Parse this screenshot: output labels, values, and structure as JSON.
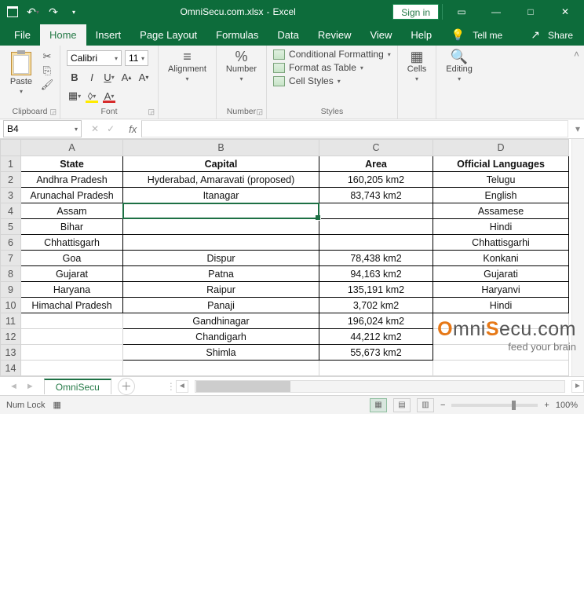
{
  "title": {
    "filename": "OmniSecu.com.xlsx",
    "appname": "Excel",
    "signin": "Sign in"
  },
  "tabs": {
    "file": "File",
    "home": "Home",
    "insert": "Insert",
    "pagelayout": "Page Layout",
    "formulas": "Formulas",
    "data": "Data",
    "review": "Review",
    "view": "View",
    "help": "Help",
    "tellme": "Tell me",
    "share": "Share"
  },
  "ribbon": {
    "clipboard": {
      "paste": "Paste",
      "label": "Clipboard"
    },
    "font": {
      "name": "Calibri",
      "size": "11",
      "label": "Font"
    },
    "alignment": {
      "btn": "Alignment"
    },
    "number": {
      "btn": "Number",
      "label": "Number"
    },
    "styles": {
      "cond": "Conditional Formatting",
      "table": "Format as Table",
      "cell": "Cell Styles",
      "label": "Styles"
    },
    "cells": {
      "btn": "Cells"
    },
    "editing": {
      "btn": "Editing"
    }
  },
  "namebox": "B4",
  "columns": [
    "A",
    "B",
    "C",
    "D"
  ],
  "rows": [
    "1",
    "2",
    "3",
    "4",
    "5",
    "6",
    "7",
    "8",
    "9",
    "10",
    "11",
    "12",
    "13",
    "14"
  ],
  "headers": {
    "state": "State",
    "capital": "Capital",
    "area": "Area",
    "lang": "Official Languages"
  },
  "data": [
    {
      "state": "Andhra Pradesh",
      "capital": "Hyderabad, Amaravati (proposed)",
      "area": "160,205 km2",
      "lang": "Telugu"
    },
    {
      "state": "Arunachal Pradesh",
      "capital": "Itanagar",
      "area": "83,743 km2",
      "lang": "English"
    },
    {
      "state": "Assam",
      "capital": "",
      "area": "",
      "lang": "Assamese"
    },
    {
      "state": "Bihar",
      "capital": "",
      "area": "",
      "lang": "Hindi"
    },
    {
      "state": "Chhattisgarh",
      "capital": "",
      "area": "",
      "lang": "Chhattisgarhi"
    },
    {
      "state": "Goa",
      "capital": "Dispur",
      "area": "78,438 km2",
      "lang": "Konkani"
    },
    {
      "state": "Gujarat",
      "capital": "Patna",
      "area": "94,163 km2",
      "lang": "Gujarati"
    },
    {
      "state": "Haryana",
      "capital": "Raipur",
      "area": "135,191 km2",
      "lang": "Haryanvi"
    },
    {
      "state": "Himachal Pradesh",
      "capital": "Panaji",
      "area": "3,702 km2",
      "lang": "Hindi"
    },
    {
      "state": "",
      "capital": "Gandhinagar",
      "area": "196,024 km2",
      "lang": ""
    },
    {
      "state": "",
      "capital": "Chandigarh",
      "area": "44,212 km2",
      "lang": ""
    },
    {
      "state": "",
      "capital": "Shimla",
      "area": "55,673 km2",
      "lang": ""
    }
  ],
  "sheet": {
    "name": "OmniSecu"
  },
  "status": {
    "numlock": "Num Lock",
    "zoom": "100%"
  },
  "watermark": {
    "pre": "Omni",
    "mid": "Secu",
    "suf": ".com",
    "sub": "feed your brain"
  }
}
